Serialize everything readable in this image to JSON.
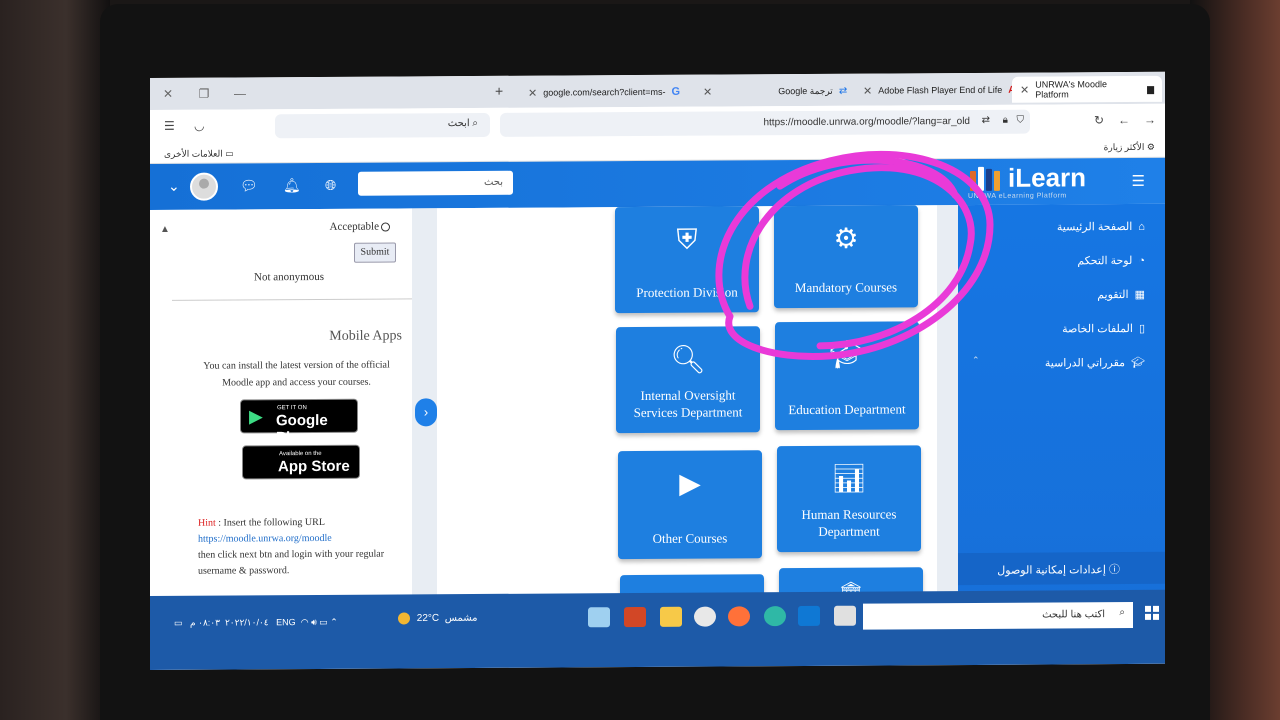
{
  "browser": {
    "tabs": [
      {
        "label": "google.com/search?client=ms-",
        "favicon": "G"
      },
      {
        "label": "Google ترجمة",
        "favicon": "translate"
      },
      {
        "label": "Adobe Flash Player End of Life",
        "favicon": "A"
      },
      {
        "label": "UNRWA's Moodle Platform",
        "favicon": "moodle"
      }
    ],
    "search_placeholder": "ابحث",
    "url": "https://moodle.unrwa.org/moodle/?lang=ar_old",
    "bookmarks_left": "العلامات الأخرى",
    "bookmarks_right": "الأكثر زيارة"
  },
  "header": {
    "search_placeholder": "بحث",
    "logo_text": "iLearn",
    "logo_subtitle": "UNRWA eLearning Platform"
  },
  "left_panel": {
    "option_label": "Acceptable",
    "submit_label": "Submit",
    "status": "Not anonymous",
    "mobile_apps_title": "Mobile Apps",
    "mobile_apps_desc": "You can install the latest version of the official Moodle app and access your courses.",
    "google_play_small": "GET IT ON",
    "google_play_big": "Google Play",
    "app_store_small": "Available on the",
    "app_store_big": "App Store",
    "hint_label": "Hint",
    "hint_text": " : Insert the following URL",
    "hint_url": "https://moodle.unrwa.org/moodle",
    "hint_text2": "then click next btn and login with your regular username & password."
  },
  "tiles": [
    {
      "label": "Protection Division",
      "icon": "shield-check-icon"
    },
    {
      "label": "Mandatory Courses",
      "icon": "document-gear-icon"
    },
    {
      "label": "Internal Oversight Services Department",
      "icon": "document-search-icon"
    },
    {
      "label": "Education Department",
      "icon": "graduation-cap-icon"
    },
    {
      "label": "Other Courses",
      "icon": "video-doc-icon"
    },
    {
      "label": "Human Resources Department",
      "icon": "presentation-icon"
    }
  ],
  "nav": {
    "items": [
      {
        "label": "الصفحة الرئيسية",
        "icon": "home-icon"
      },
      {
        "label": "لوحة التحكم",
        "icon": "dashboard-icon"
      },
      {
        "label": "التقويم",
        "icon": "calendar-icon"
      },
      {
        "label": "الملفات الخاصة",
        "icon": "files-icon"
      },
      {
        "label": "مقرراتي الدراسية",
        "icon": "cap-icon"
      }
    ],
    "accessibility": "إعدادات إمكانية الوصول"
  },
  "taskbar": {
    "search_placeholder": "اكتب هنا للبحث",
    "weather_temp": "22°C",
    "weather_text": "مشمس",
    "lang": "ENG",
    "time": "٠٨:٠٣ م",
    "date": "٢٠٢٢/١٠/٠٤"
  },
  "colors": {
    "primary": "#1e7fe0",
    "annotation": "#e93ad8"
  }
}
